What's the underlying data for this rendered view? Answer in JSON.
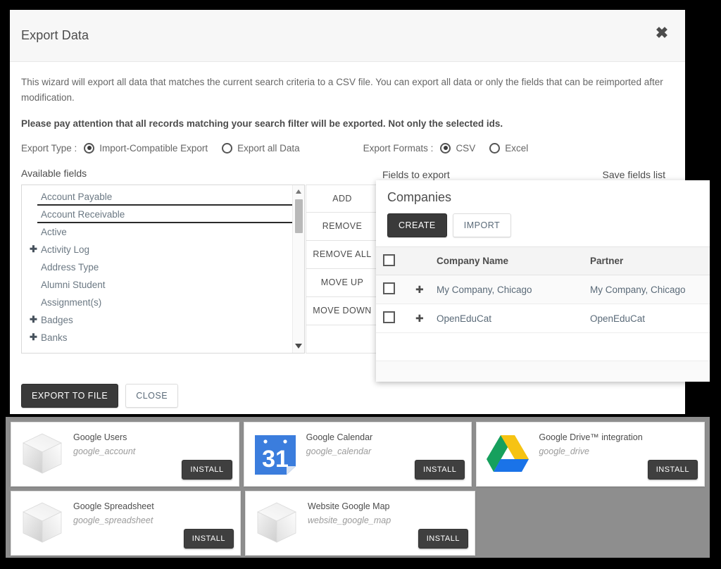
{
  "dialog": {
    "title": "Export Data",
    "close_icon": "close-icon",
    "intro": "This wizard will export all data that matches the current search criteria to a CSV file. You can export all data or only the fields that can be reimported after modification.",
    "warning": "Please pay attention that all records matching your search filter will be exported. Not only the selected ids.",
    "export_type_label": "Export Type :",
    "export_type_options": [
      {
        "label": "Import-Compatible Export",
        "checked": true
      },
      {
        "label": "Export all Data",
        "checked": false
      }
    ],
    "export_formats_label": "Export Formats :",
    "export_format_options": [
      {
        "label": "CSV",
        "checked": true
      },
      {
        "label": "Excel",
        "checked": false
      }
    ],
    "available_fields_label": "Available fields",
    "available_fields": [
      {
        "label": "Account Payable",
        "expandable": false,
        "selected": true
      },
      {
        "label": "Account Receivable",
        "expandable": false,
        "selected": true
      },
      {
        "label": "Active",
        "expandable": false,
        "selected": false
      },
      {
        "label": "Activity Log",
        "expandable": true,
        "selected": false
      },
      {
        "label": "Address Type",
        "expandable": false,
        "selected": false
      },
      {
        "label": "Alumni Student",
        "expandable": false,
        "selected": false
      },
      {
        "label": "Assignment(s)",
        "expandable": false,
        "selected": false
      },
      {
        "label": "Badges",
        "expandable": true,
        "selected": false
      },
      {
        "label": "Banks",
        "expandable": true,
        "selected": false
      }
    ],
    "transfer_buttons": [
      "ADD",
      "REMOVE",
      "REMOVE ALL",
      "MOVE UP",
      "MOVE DOWN"
    ],
    "fields_to_export_label": "Fields to export",
    "save_fields_list_label": "Save fields list",
    "footer": {
      "primary": "EXPORT TO FILE",
      "secondary": "CLOSE"
    }
  },
  "companies": {
    "title": "Companies",
    "create_label": "CREATE",
    "import_label": "IMPORT",
    "columns": [
      "",
      "",
      "Company Name",
      "Partner"
    ],
    "rows": [
      {
        "name": "My Company, Chicago",
        "partner": "My Company, Chicago"
      },
      {
        "name": "OpenEduCat",
        "partner": "OpenEduCat"
      }
    ],
    "drag_icon": "drag-handle-icon",
    "checkbox_icon": "checkbox-unchecked-icon"
  },
  "apps": {
    "install_label": "INSTALL",
    "cards": [
      {
        "name": "Google Users",
        "technical": "google_account",
        "icon": "default-module-cube-icon"
      },
      {
        "name": "Google Calendar",
        "technical": "google_calendar",
        "icon": "google-calendar-icon"
      },
      {
        "name": "Google Drive™ integration",
        "technical": "google_drive",
        "icon": "google-drive-icon"
      },
      {
        "name": "Google Spreadsheet",
        "technical": "google_spreadsheet",
        "icon": "default-module-cube-icon"
      },
      {
        "name": "Website Google Map",
        "technical": "website_google_map",
        "icon": "default-module-cube-icon"
      }
    ]
  },
  "colors": {
    "accent_dark": "#3a3a3a",
    "text_muted": "#666666",
    "link": "#5a6a78",
    "panel_grey": "#8e8e8e",
    "calendar_blue": "#3b7ddd",
    "drive_green": "#16a05d",
    "drive_yellow": "#f6c313",
    "drive_blue": "#1a73e8"
  }
}
